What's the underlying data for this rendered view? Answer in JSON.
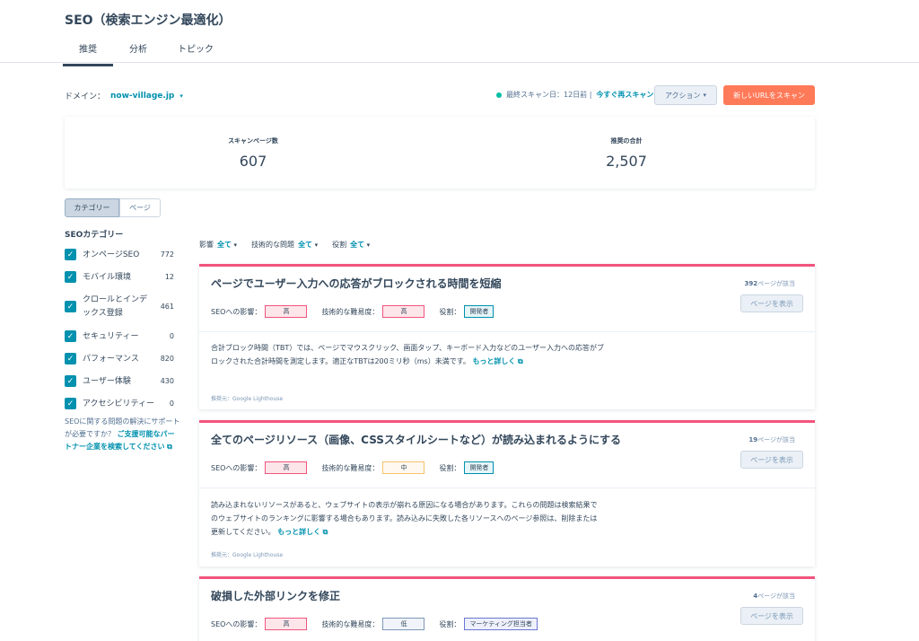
{
  "header": {
    "title": "SEO（検索エンジン最適化）",
    "tabs": [
      {
        "label": "推奨"
      },
      {
        "label": "分析"
      },
      {
        "label": "トピック"
      }
    ]
  },
  "domain": {
    "label": "ドメイン：",
    "value": "now-village.jp"
  },
  "scan": {
    "last_scan": "最終スキャン日：12日前 |",
    "rescan": "今すぐ再スキャン"
  },
  "actions": {
    "action_label": "アクション",
    "scan_new_label": "新しいURLをスキャン"
  },
  "stats": {
    "scanned_label": "スキャンページ数",
    "scanned_value": "607",
    "total_label": "推奨の合計",
    "total_value": "2,507"
  },
  "view_toggle": {
    "category": "カテゴリー",
    "page": "ページ"
  },
  "sidebar": {
    "title": "SEOカテゴリー",
    "items": [
      {
        "label": "オンページSEO",
        "count": "772"
      },
      {
        "label": "モバイル環境",
        "count": "12"
      },
      {
        "label": "クロールとインデックス登録",
        "count": "461"
      },
      {
        "label": "セキュリティー",
        "count": "0"
      },
      {
        "label": "パフォーマンス",
        "count": "820"
      },
      {
        "label": "ユーザー体験",
        "count": "430"
      },
      {
        "label": "アクセシビリティー",
        "count": "0"
      }
    ],
    "help_text": "SEOに関する問題の解決にサポートが必要ですか？",
    "help_link": "ご支援可能なパートナー企業を検索してください"
  },
  "filters": {
    "impact_label": "影響",
    "impact_value": "全て",
    "tech_label": "技術的な問題",
    "tech_value": "全て",
    "role_label": "役割",
    "role_value": "全て"
  },
  "labels": {
    "impact": "SEOへの影響：",
    "difficulty": "技術的な難易度：",
    "role": "役割：",
    "view_pages": "ページを表示",
    "pages_suffix": "ページが該当"
  },
  "recommendations": [
    {
      "title": "ページでユーザー入力への応答がブロックされる時間を短縮",
      "page_count": "392",
      "impact": "高",
      "difficulty": "高",
      "role": "開発者",
      "description": "合計ブロック時間（TBT）では、ページでマウスクリック、画面タップ、キーボード入力などのユーザー入力への応答がブロックされた合計時間を測定します。適正なTBTは200ミリ秒（ms）未満です。",
      "more": "もっと詳しく",
      "source": "推奨元：Google Lighthouse"
    },
    {
      "title": "全てのページリソース（画像、CSSスタイルシートなど）が読み込まれるようにする",
      "page_count": "19",
      "impact": "高",
      "difficulty": "中",
      "role": "開発者",
      "description": "読み込まれないリソースがあると、ウェブサイトの表示が崩れる原因になる場合があります。これらの問題は検索結果でのウェブサイトのランキングに影響する場合もあります。読み込みに失敗した各リソースへのページ参照は、削除または更新してください。",
      "more": "もっと詳しく",
      "source": "推奨元：Google Lighthouse"
    },
    {
      "title": "破損した外部リンクを修正",
      "page_count": "4",
      "impact": "高",
      "difficulty": "低",
      "role": "マーケティング担当者"
    }
  ],
  "colors": {
    "accent": "#0091ae",
    "primary_button": "#ff7a59",
    "card_top": "#f2547d"
  }
}
